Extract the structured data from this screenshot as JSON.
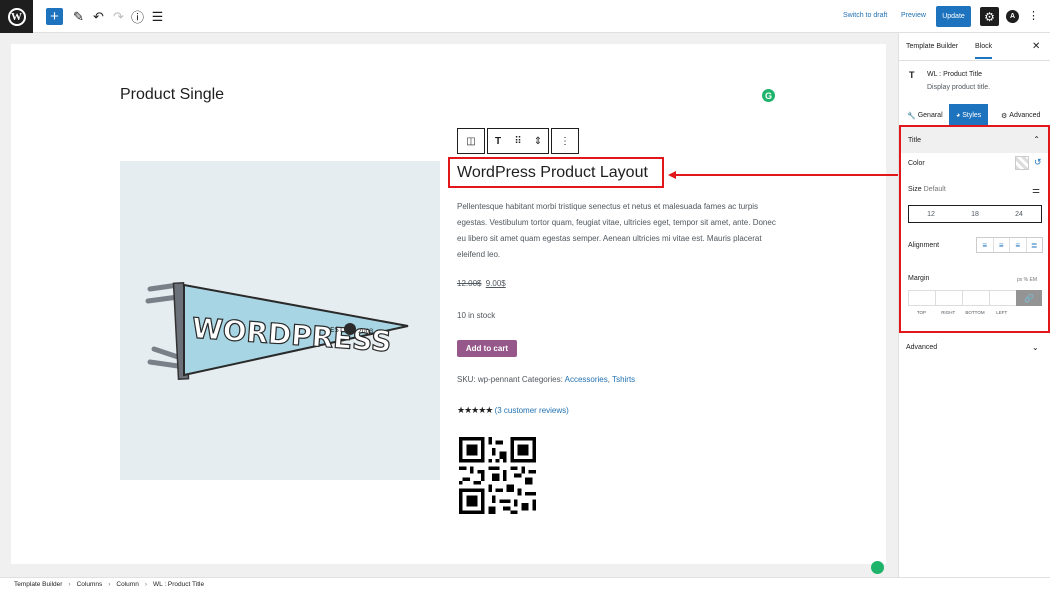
{
  "header": {
    "add_icon": "+",
    "tools": [
      "pencil-icon",
      "undo-icon",
      "redo-icon",
      "info-icon",
      "list-view-icon"
    ],
    "switch_draft": "Switch to draft",
    "preview": "Preview",
    "update": "Update"
  },
  "canvas": {
    "page_title": "Product Single",
    "product_title": "WordPress Product Layout",
    "description": "Pellentesque habitant morbi tristique senectus et netus et malesuada fames ac turpis egestas. Vestibulum tortor quam, feugiat vitae, ultricies eget, tempor sit amet, ante. Donec eu libero sit amet quam egestas semper. Aenean ultricies mi vitae est. Mauris placerat eleifend leo.",
    "price_old": "12.00$",
    "price_new": "9.00$",
    "stock": "10 in stock",
    "add_to_cart": "Add to cart",
    "sku_text": "SKU: wp-pennant Categories: ",
    "cat1": "Accessories",
    "cat_sep": ", ",
    "cat2": "Tshirts",
    "stars": "★★★★★",
    "rating_link": "(3 customer reviews)",
    "rating_value": 5,
    "pennant_text": "WORDPRESS",
    "pennant_est": "EST",
    "pennant_year": "2003"
  },
  "sidebar": {
    "tab_builder": "Template Builder",
    "tab_block": "Block",
    "block_name": "WL : Product Title",
    "block_desc": "Display product title.",
    "subtab_general": "Genaral",
    "subtab_styles": "Styles",
    "subtab_advanced": "Advanced",
    "panel_title": "Title",
    "color_label": "Color",
    "size_label": "Size",
    "size_value": "Default",
    "sizes": [
      "12",
      "18",
      "24"
    ],
    "alignment_label": "Alignment",
    "margin_label": "Margin",
    "units": "px  %  EM",
    "margin_sides": [
      "TOP",
      "RIGHT",
      "BOTTOM",
      "LEFT"
    ],
    "advanced_label": "Advanced"
  },
  "footer": {
    "crumbs": [
      "Template Builder",
      "Columns",
      "Column",
      "WL : Product Title"
    ],
    "separator": "›"
  },
  "colors": {
    "accent": "#1e73be",
    "highlight": "#e2171c",
    "cart": "#96588a",
    "pennant": "#a8d5e4"
  }
}
